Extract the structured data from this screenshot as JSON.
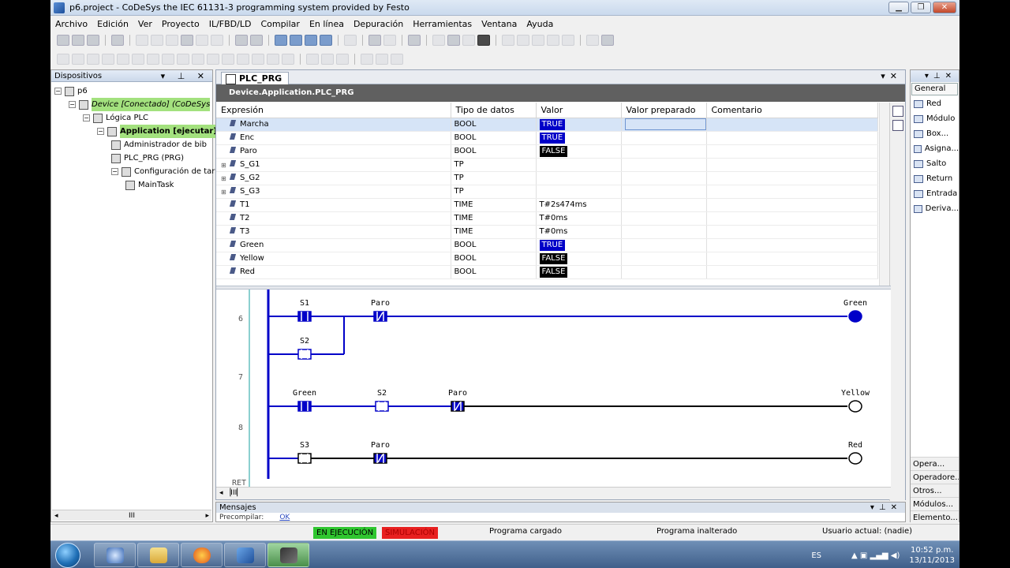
{
  "window": {
    "title": "p6.project - CoDeSys the IEC 61131-3 programming system provided by Festo"
  },
  "menu": [
    "Archivo",
    "Edición",
    "Ver",
    "Proyecto",
    "IL/FBD/LD",
    "Compilar",
    "En línea",
    "Depuración",
    "Herramientas",
    "Ventana",
    "Ayuda"
  ],
  "devices": {
    "header": "Dispositivos",
    "items": [
      {
        "label": "p6",
        "depth": 0
      },
      {
        "label": "Device [Conectado] (CoDeSys",
        "depth": 1
      },
      {
        "label": "Lógica PLC",
        "depth": 2
      },
      {
        "label": "Application [ejecutar]",
        "depth": 3
      },
      {
        "label": "Administrador de bib",
        "depth": 4
      },
      {
        "label": "PLC_PRG (PRG)",
        "depth": 4
      },
      {
        "label": "Configuración de tar",
        "depth": 4
      },
      {
        "label": "MainTask",
        "depth": 5
      }
    ],
    "scroll_label": "III"
  },
  "editor": {
    "tab": "PLC_PRG",
    "path": "Device.Application.PLC_PRG",
    "columns": [
      "Expresión",
      "Tipo de datos",
      "Valor",
      "Valor preparado",
      "Comentario"
    ],
    "rows": [
      {
        "name": "Marcha",
        "type": "BOOL",
        "value": "TRUE",
        "expand": ""
      },
      {
        "name": "Enc",
        "type": "BOOL",
        "value": "TRUE",
        "expand": ""
      },
      {
        "name": "Paro",
        "type": "BOOL",
        "value": "FALSE",
        "expand": ""
      },
      {
        "name": "S_G1",
        "type": "TP",
        "value": "",
        "expand": "⊞"
      },
      {
        "name": "S_G2",
        "type": "TP",
        "value": "",
        "expand": "⊞"
      },
      {
        "name": "S_G3",
        "type": "TP",
        "value": "",
        "expand": "⊞"
      },
      {
        "name": "T1",
        "type": "TIME",
        "value": "T#2s474ms",
        "expand": ""
      },
      {
        "name": "T2",
        "type": "TIME",
        "value": "T#0ms",
        "expand": ""
      },
      {
        "name": "T3",
        "type": "TIME",
        "value": "T#0ms",
        "expand": ""
      },
      {
        "name": "Green",
        "type": "BOOL",
        "value": "TRUE",
        "expand": ""
      },
      {
        "name": "Yellow",
        "type": "BOOL",
        "value": "FALSE",
        "expand": ""
      },
      {
        "name": "Red",
        "type": "BOOL",
        "value": "FALSE",
        "expand": ""
      }
    ]
  },
  "ladder": {
    "rung_numbers": [
      "6",
      "7",
      "8"
    ],
    "end_label": "RET",
    "labels": [
      "S1",
      "Paro",
      "Green",
      "S2",
      "Green",
      "S2",
      "Paro",
      "Yellow",
      "S3",
      "Paro",
      "Red"
    ]
  },
  "right_panel": {
    "tab": "General",
    "items": [
      "Red",
      "Módulo",
      "Box...",
      "Asigna...",
      "Salto",
      "Return",
      "Entrada",
      "Deriva..."
    ],
    "bottom": [
      "Opera...",
      "Operadore...",
      "Otros...",
      "Módulos...",
      "Elemento..."
    ]
  },
  "messages": {
    "header": "Mensajes",
    "text": "Precompilar:",
    "link": "OK"
  },
  "status": {
    "running": "EN EJECUCIÓN",
    "simulation": "SIMULACIÓN",
    "program": "Programa cargado",
    "program_state": "Programa inalterado",
    "user": "Usuario actual: (nadie)"
  },
  "taskbar": {
    "lang": "ES",
    "time": "10:52 p.m.",
    "date": "13/11/2013"
  },
  "colors": {
    "true_bg": "#0000c8",
    "false_bg": "#000000",
    "run": "#2fc62f",
    "sim": "#e82020",
    "wire_live": "#0000c8"
  }
}
